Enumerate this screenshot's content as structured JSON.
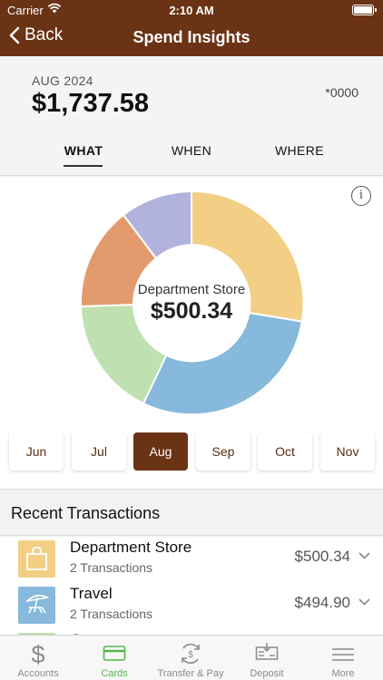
{
  "status_bar": {
    "carrier": "Carrier",
    "time": "2:10 AM"
  },
  "nav": {
    "back_label": "Back",
    "title": "Spend Insights"
  },
  "summary": {
    "period": "AUG 2024",
    "amount": "$1,737.58",
    "account": "*0000",
    "tabs": {
      "what": "WHAT",
      "when": "WHEN",
      "where": "WHERE"
    },
    "active_tab": "WHAT"
  },
  "chart": {
    "center_label": "Department Store",
    "center_amount": "$500.34",
    "info_glyph": "i",
    "segments": [
      {
        "color": "#f2cf85",
        "value": 500.34
      },
      {
        "color": "#86b9db",
        "value": 494.9
      },
      {
        "color": "#bfe0b0",
        "value": 283.0
      },
      {
        "color": "#e39b6e",
        "value": 265.0
      },
      {
        "color": "#b2b3dd",
        "value": 194.34
      }
    ]
  },
  "months": [
    "Jun",
    "Jul",
    "Aug",
    "Sep",
    "Oct",
    "Nov"
  ],
  "selected_month": "Aug",
  "recent": {
    "heading": "Recent Transactions",
    "items": [
      {
        "name": "Department Store",
        "count": "2 Transactions",
        "amount": "$500.34",
        "icon": "shopping-bag-icon",
        "color": "#f2cf85"
      },
      {
        "name": "Travel",
        "count": "2 Transactions",
        "amount": "$494.90",
        "icon": "beach-chair-icon",
        "color": "#86b9db"
      },
      {
        "name": "Gr",
        "icon": "",
        "color": "#bfe0b0"
      }
    ]
  },
  "tab_bar": {
    "items": [
      {
        "label": "Accounts",
        "icon": "dollar-icon"
      },
      {
        "label": "Cards",
        "icon": "card-icon"
      },
      {
        "label": "Transfer & Pay",
        "icon": "transfer-icon"
      },
      {
        "label": "Deposit",
        "icon": "deposit-check-icon"
      },
      {
        "label": "More",
        "icon": "menu-icon"
      }
    ],
    "active": "Cards",
    "active_color": "#55b84a"
  },
  "colors": {
    "brand": "#6a3315"
  }
}
